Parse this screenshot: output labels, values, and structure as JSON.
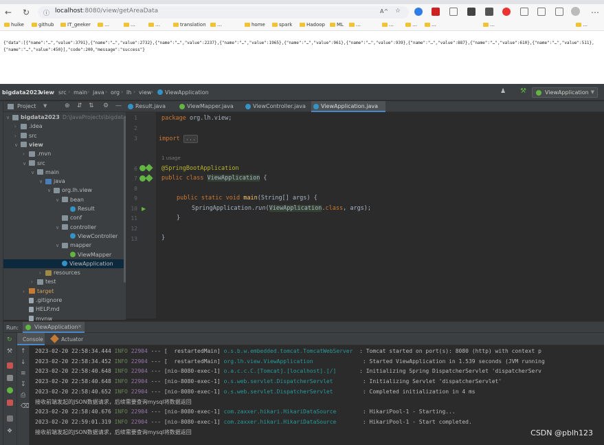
{
  "browser": {
    "url_host": "localhost",
    "url_path": ":8080/view/getAreaData",
    "reader_mode_icon": "A^",
    "bookmarks": [
      "huike",
      "github",
      "IT_geeker",
      "…",
      "…",
      "…",
      "translation",
      "…",
      "home",
      "spark",
      "Hadoop",
      "ML",
      "…",
      "…",
      "…",
      "…",
      "…",
      "…"
    ],
    "page_text": "{\"data\":[{\"name\":\"…\",\"value\":3791},{\"name\":\"…\",\"value\":2732},{\"name\":\"…\",\"value\":2237},{\"name\":\"…\",\"value\":1965},{\"name\":\"…\",\"value\":961},{\"name\":\"…\",\"value\":939},{\"name\":\"…\",\"value\":887},{\"name\":\"…\",\"value\":610},{\"name\":\"…\",\"value\":511},{\"name\":\"…\",\"value\":450}],\"code\":200,\"message\":\"success\"}"
  },
  "ide": {
    "breadcrumbs": [
      "bigdata2023",
      "view",
      "src",
      "main",
      "java",
      "org",
      "lh",
      "view",
      "ViewApplication"
    ],
    "run_config": "ViewApplication",
    "project_label": "Project",
    "tree": [
      {
        "label": "bigdata2023",
        "hint": "D:\\JavaProjects\\bigdata2023",
        "depth": 0,
        "arrow": "v",
        "icon": "folder"
      },
      {
        "label": ".idea",
        "depth": 1,
        "arrow": ">",
        "icon": "folder"
      },
      {
        "label": "src",
        "depth": 1,
        "arrow": ">",
        "icon": "folder"
      },
      {
        "label": "view",
        "depth": 1,
        "arrow": "v",
        "icon": "folder"
      },
      {
        "label": ".mvn",
        "depth": 2,
        "arrow": ">",
        "icon": "folder"
      },
      {
        "label": "src",
        "depth": 2,
        "arrow": "v",
        "icon": "folder"
      },
      {
        "label": "main",
        "depth": 3,
        "arrow": "v",
        "icon": "folder"
      },
      {
        "label": "java",
        "depth": 4,
        "arrow": "v",
        "icon": "folder src"
      },
      {
        "label": "org.lh.view",
        "depth": 5,
        "arrow": "v",
        "icon": "folder"
      },
      {
        "label": "bean",
        "depth": 6,
        "arrow": "v",
        "icon": "folder"
      },
      {
        "label": "Result",
        "depth": 7,
        "arrow": "",
        "icon": "cls"
      },
      {
        "label": "conf",
        "depth": 6,
        "arrow": "",
        "icon": "folder"
      },
      {
        "label": "controller",
        "depth": 6,
        "arrow": "v",
        "icon": "folder"
      },
      {
        "label": "ViewController",
        "depth": 7,
        "arrow": "",
        "icon": "cls"
      },
      {
        "label": "mapper",
        "depth": 6,
        "arrow": "v",
        "icon": "folder"
      },
      {
        "label": "ViewMapper",
        "depth": 7,
        "arrow": "",
        "icon": "iface"
      },
      {
        "label": "ViewApplication",
        "depth": 6,
        "arrow": "",
        "icon": "cls",
        "selected": true
      },
      {
        "label": "resources",
        "depth": 4,
        "arrow": ">",
        "icon": "folder res"
      },
      {
        "label": "test",
        "depth": 3,
        "arrow": ">",
        "icon": "folder"
      },
      {
        "label": "target",
        "depth": 2,
        "arrow": ">",
        "icon": "folder tgt"
      },
      {
        "label": ".gitignore",
        "depth": 2,
        "arrow": "",
        "icon": "file"
      },
      {
        "label": "HELP.md",
        "depth": 2,
        "arrow": "",
        "icon": "file"
      },
      {
        "label": "mvnw",
        "depth": 2,
        "arrow": "",
        "icon": "file"
      }
    ],
    "tabs": [
      {
        "label": "Result.java",
        "color": "#3592c4"
      },
      {
        "label": "ViewMapper.java",
        "color": "#62b543"
      },
      {
        "label": "ViewController.java",
        "color": "#3592c4"
      },
      {
        "label": "ViewApplication.java",
        "color": "#3592c4",
        "active": true
      }
    ],
    "code": {
      "line_numbers": [
        "1",
        "2",
        "3",
        "",
        "6",
        "7",
        "8",
        "9",
        "10",
        "11",
        "12",
        "13"
      ],
      "pkg_kw": "package",
      "pkg_name": " org.lh.view;",
      "import_kw": "import",
      "import_fold": "...",
      "usage_hint": "1 usage",
      "annotation": "@SpringBootApplication",
      "class_decl_kw": "public class",
      "class_name": "ViewApplication",
      "class_open": " {",
      "main_kw": "public static void",
      "main_name": "main",
      "main_params": "(String[] args) {",
      "run_prefix": "SpringApplication.",
      "run_method": "run",
      "run_arg_open": "(",
      "run_arg_class": "ViewApplication",
      "run_arg_mid": ".",
      "run_arg_kw": "class",
      "run_arg_end": ", args);",
      "close_inner": "}",
      "close_outer": "}"
    },
    "run": {
      "run_label": "Run:",
      "run_tab": "ViewApplication",
      "console_tab": "Console",
      "actuator_tab": "Actuator",
      "logs": [
        {
          "ts": "2023-02-20 22:58:34.444",
          "level": "INFO",
          "pid": "22904",
          "sep": " --- [  restartedMain] ",
          "logger": "o.s.b.w.embedded.tomcat.TomcatWebServer",
          "msg": "  : Tomcat started on port(s): 8080 (http) with context p"
        },
        {
          "ts": "2023-02-20 22:58:34.452",
          "level": "INFO",
          "pid": "22904",
          "sep": " --- [  restartedMain] ",
          "logger": "org.lh.view.ViewApplication             ",
          "msg": "  : Started ViewApplication in 1.539 seconds (JVM running"
        },
        {
          "ts": "2023-02-20 22:58:40.648",
          "level": "INFO",
          "pid": "22904",
          "sep": " --- [nio-8080-exec-1] ",
          "logger": "o.a.c.c.C.[Tomcat].[localhost].[/]     ",
          "msg": "  : Initializing Spring DispatcherServlet 'dispatcherServ"
        },
        {
          "ts": "2023-02-20 22:58:40.648",
          "level": "INFO",
          "pid": "22904",
          "sep": " --- [nio-8080-exec-1] ",
          "logger": "o.s.web.servlet.DispatcherServlet       ",
          "msg": "  : Initializing Servlet 'dispatcherServlet'"
        },
        {
          "ts": "2023-02-20 22:58:40.652",
          "level": "INFO",
          "pid": "22904",
          "sep": " --- [nio-8080-exec-1] ",
          "logger": "o.s.web.servlet.DispatcherServlet       ",
          "msg": "  : Completed initialization in 4 ms"
        }
      ],
      "plain1": "接收前端发起的JSON数据请求，后续需要查询mysql将数据返回",
      "logs2": [
        {
          "ts": "2023-02-20 22:58:40.676",
          "level": "INFO",
          "pid": "22904",
          "sep": " --- [nio-8080-exec-1] ",
          "logger": "com.zaxxer.hikari.HikariDataSource      ",
          "msg": "  : HikariPool-1 - Starting..."
        },
        {
          "ts": "2023-02-20 22:59:01.319",
          "level": "INFO",
          "pid": "22904",
          "sep": " --- [nio-8080-exec-1] ",
          "logger": "com.zaxxer.hikari.HikariDataSource      ",
          "msg": "  : HikariPool-1 - Start completed."
        }
      ],
      "plain2": "接收前端发起的JSON数据请求，后续需要查询mysql将数据返回"
    },
    "watermark": "CSDN @pblh123"
  }
}
